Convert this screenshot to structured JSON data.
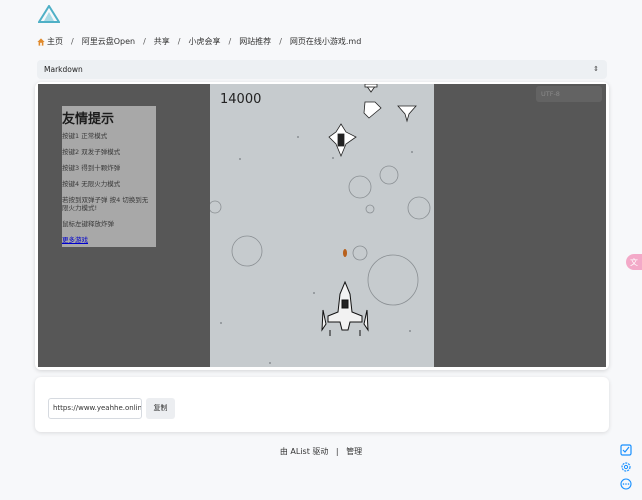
{
  "breadcrumb": {
    "home": "主页",
    "items": [
      "阿里云盘Open",
      "共享",
      "小虎会享",
      "网站推荐",
      "网页在线小游戏.md"
    ],
    "separator": "/"
  },
  "viewer": {
    "mode": "Markdown",
    "encoding": "UTF-8"
  },
  "game": {
    "score": "14000",
    "tips_title": "友情提示",
    "tips": [
      "按键1 正常模式",
      "按键2 双发子弹模式",
      "按键3 得到十颗炸弹",
      "按键4 无限火力模式",
      "若按到双弹子弹 按4 切换到无限火力模式!",
      "鼠标左键释放炸弹"
    ],
    "more_link": "更多游戏"
  },
  "url_box": {
    "value": "https://www.yeahhe.online",
    "copy_label": "复制"
  },
  "footer": {
    "powered": "由 AList 驱动",
    "separator": "|",
    "manage": "管理"
  },
  "colors": {
    "accent": "#1890ff",
    "logo": "#4fb0c6",
    "game_bg": "#575757",
    "canvas_bg": "#c6cbce",
    "side_pill": "#f3a9c8"
  }
}
